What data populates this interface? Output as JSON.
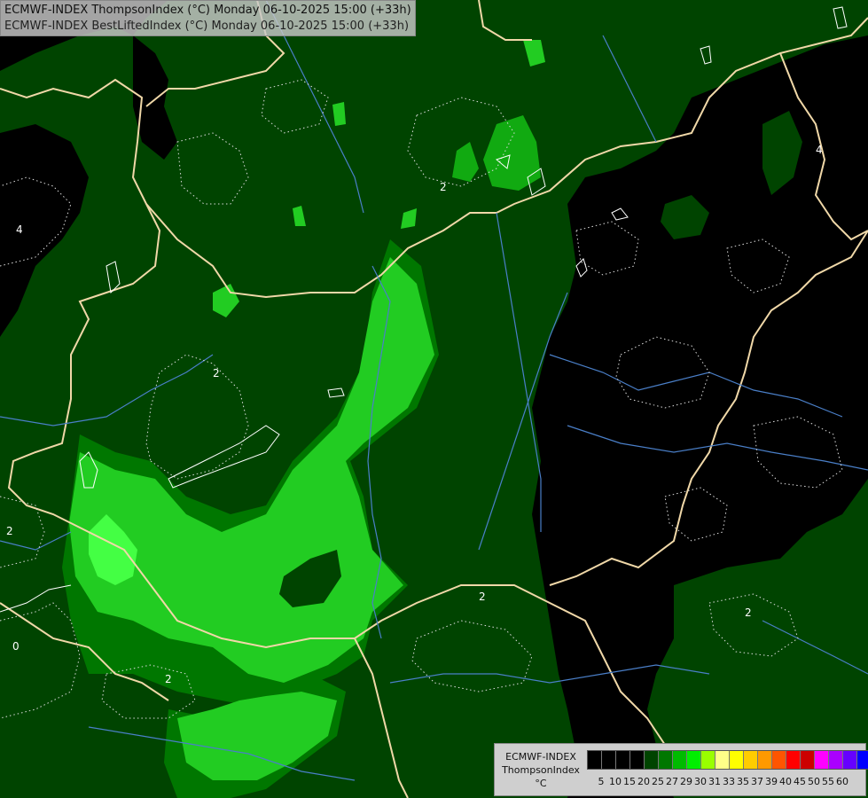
{
  "title": {
    "line1": "ECMWF-INDEX ThompsonIndex (°C) Monday 06-10-2025 15:00 (+33h)",
    "line2": "ECMWF-INDEX BestLiftedIndex (°C) Monday 06-10-2025 15:00 (+33h)"
  },
  "legend": {
    "model": "ECMWF-INDEX",
    "parameter": "ThompsonIndex",
    "unit": "°C",
    "ticks": [
      "5",
      "10",
      "15",
      "20",
      "25",
      "27",
      "29",
      "30",
      "31",
      "33",
      "35",
      "37",
      "39",
      "40",
      "45",
      "50",
      "55",
      "60"
    ],
    "colors": [
      "#000000",
      "#000000",
      "#000000",
      "#000000",
      "#004400",
      "#007700",
      "#00bb00",
      "#00ee00",
      "#99ff00",
      "#ffff88",
      "#ffff00",
      "#ffcc00",
      "#ff9900",
      "#ff5500",
      "#ff0000",
      "#cc0000",
      "#ff00ff",
      "#aa00ff",
      "#6600ff",
      "#0000ff"
    ]
  },
  "map": {
    "colors": {
      "background": "#000000",
      "dark_green": "#004400",
      "mid_green": "#007700",
      "light_green": "#22cc22",
      "bright_green": "#44ff44",
      "border": "#f0d8a8",
      "river": "#4a7fc8",
      "contour": "#ffffff"
    },
    "contour_labels": [
      "2",
      "2",
      "2",
      "2",
      "2",
      "2",
      "4",
      "4",
      "0"
    ]
  }
}
